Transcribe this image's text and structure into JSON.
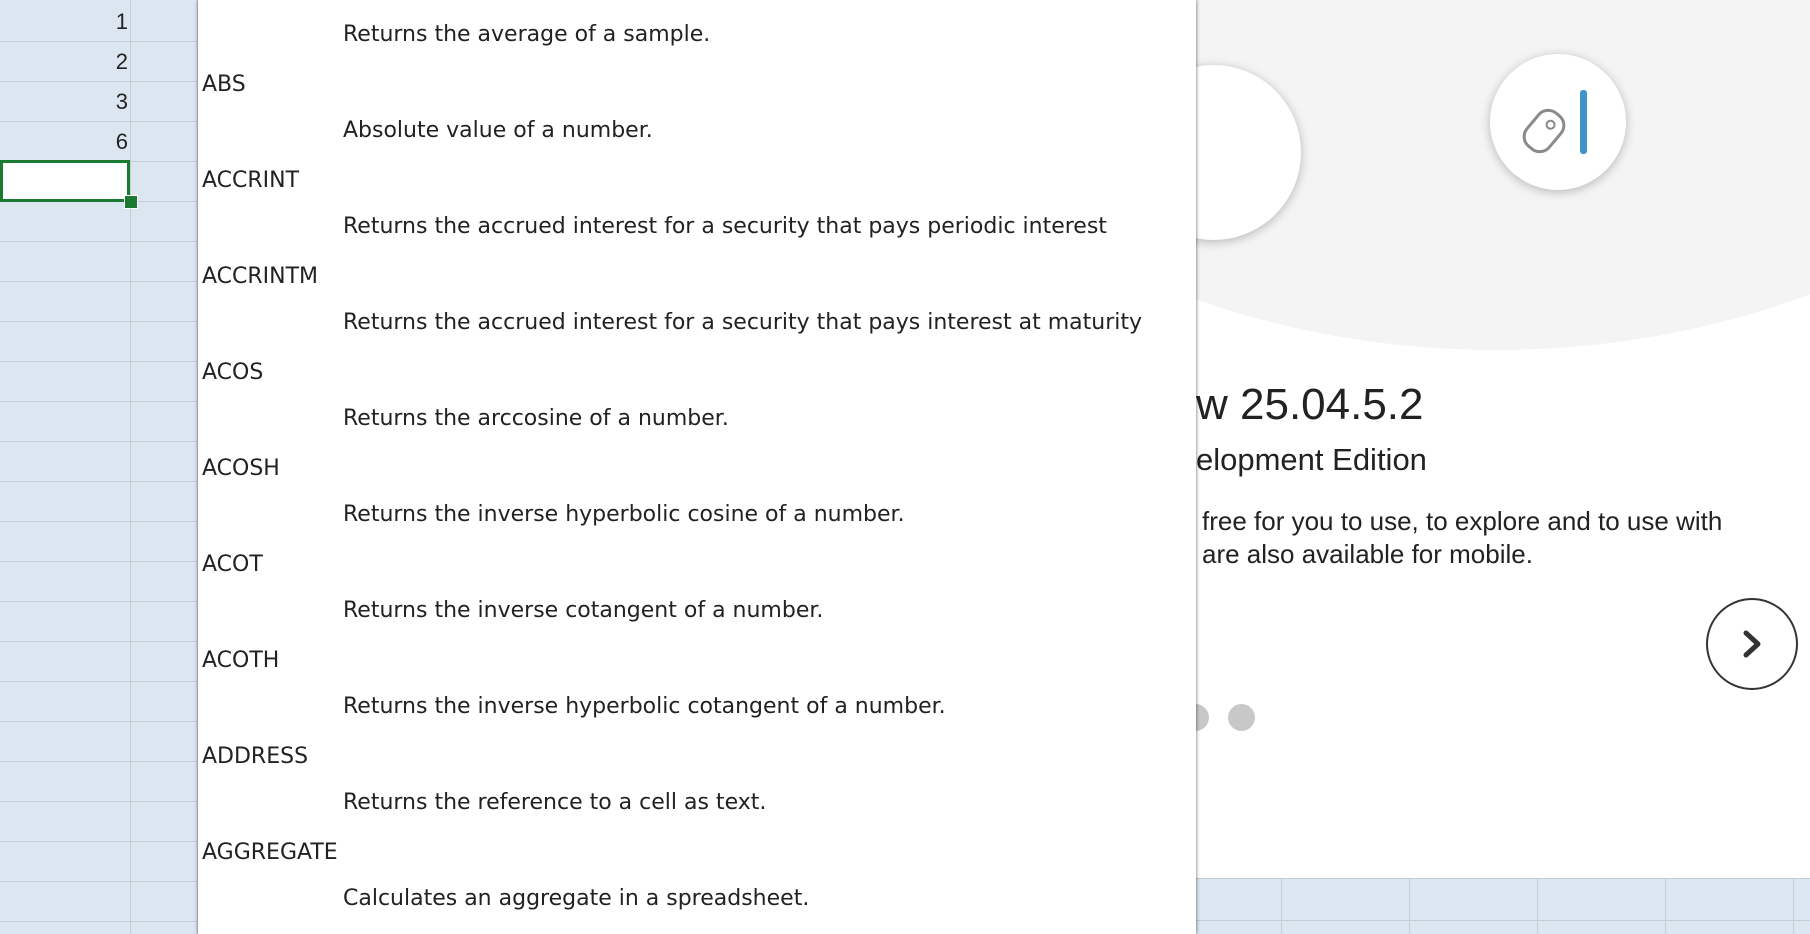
{
  "sheet": {
    "row_values": [
      "1",
      "2",
      "3",
      "6"
    ]
  },
  "function_list": {
    "top_description": "Returns the average of a sample.",
    "items": [
      {
        "name": "ABS",
        "description": "Absolute value of a number."
      },
      {
        "name": "ACCRINT",
        "description": "Returns the accrued interest for a security that pays periodic interest"
      },
      {
        "name": "ACCRINTM",
        "description": "Returns the accrued interest for a security that pays interest at maturity"
      },
      {
        "name": "ACOS",
        "description": "Returns the arccosine of a number."
      },
      {
        "name": "ACOSH",
        "description": "Returns the inverse hyperbolic cosine of a number."
      },
      {
        "name": "ACOT",
        "description": "Returns the inverse cotangent of a number."
      },
      {
        "name": "ACOTH",
        "description": "Returns the inverse hyperbolic cotangent of a number."
      },
      {
        "name": "ADDRESS",
        "description": "Returns the reference to a cell as text."
      },
      {
        "name": "AGGREGATE",
        "description": "Calculates an aggregate in a spreadsheet."
      }
    ]
  },
  "welcome": {
    "version": "w 25.04.5.2",
    "edition": "elopment Edition",
    "description_line1": "free for you to use, to explore and to use with",
    "description_line2": "are also available for mobile.",
    "next_icon": "chevron-right-icon",
    "accent_color": "#3d94cc"
  },
  "colors": {
    "selection": "#1a7a32",
    "grid_background": "#dce6f0"
  }
}
